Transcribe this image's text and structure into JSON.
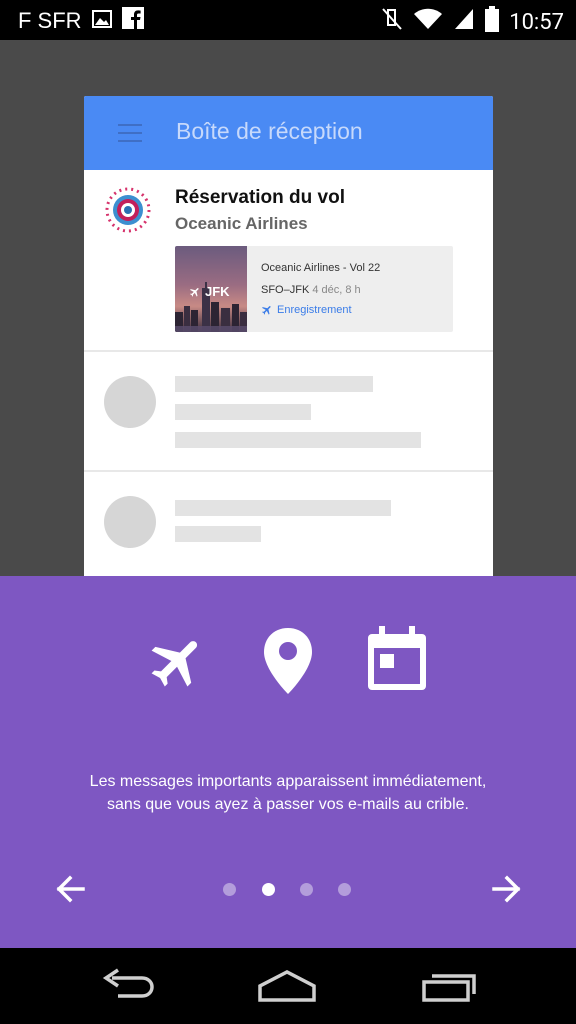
{
  "status_bar": {
    "carrier": "F SFR",
    "time": "10:57",
    "left_icons": [
      "image-icon",
      "facebook-icon"
    ],
    "right_icons": [
      "mute-icon",
      "wifi-icon",
      "signal-icon",
      "battery-icon"
    ]
  },
  "card": {
    "title": "Boîte de réception",
    "header_color": "#4a8af4",
    "mail": {
      "title": "Réservation du vol",
      "sender": "Oceanic Airlines",
      "flight": {
        "image_label": "JFK",
        "name": "Oceanic Airlines - Vol 22",
        "route": "SFO–JFK",
        "date": "4 déc, 8 h",
        "checkin": "Enregistrement"
      }
    }
  },
  "panel": {
    "color": "#7e57c2",
    "icons": [
      "airplane-icon",
      "location-pin-icon",
      "calendar-icon"
    ],
    "text_line1": "Les messages importants apparaissent immédiatement,",
    "text_line2": "sans que vous ayez à passer vos e-mails au crible.",
    "pager": {
      "count": 4,
      "active_index": 1
    }
  },
  "nav_bar": {
    "buttons": [
      "back-button",
      "home-button",
      "recents-button"
    ]
  }
}
